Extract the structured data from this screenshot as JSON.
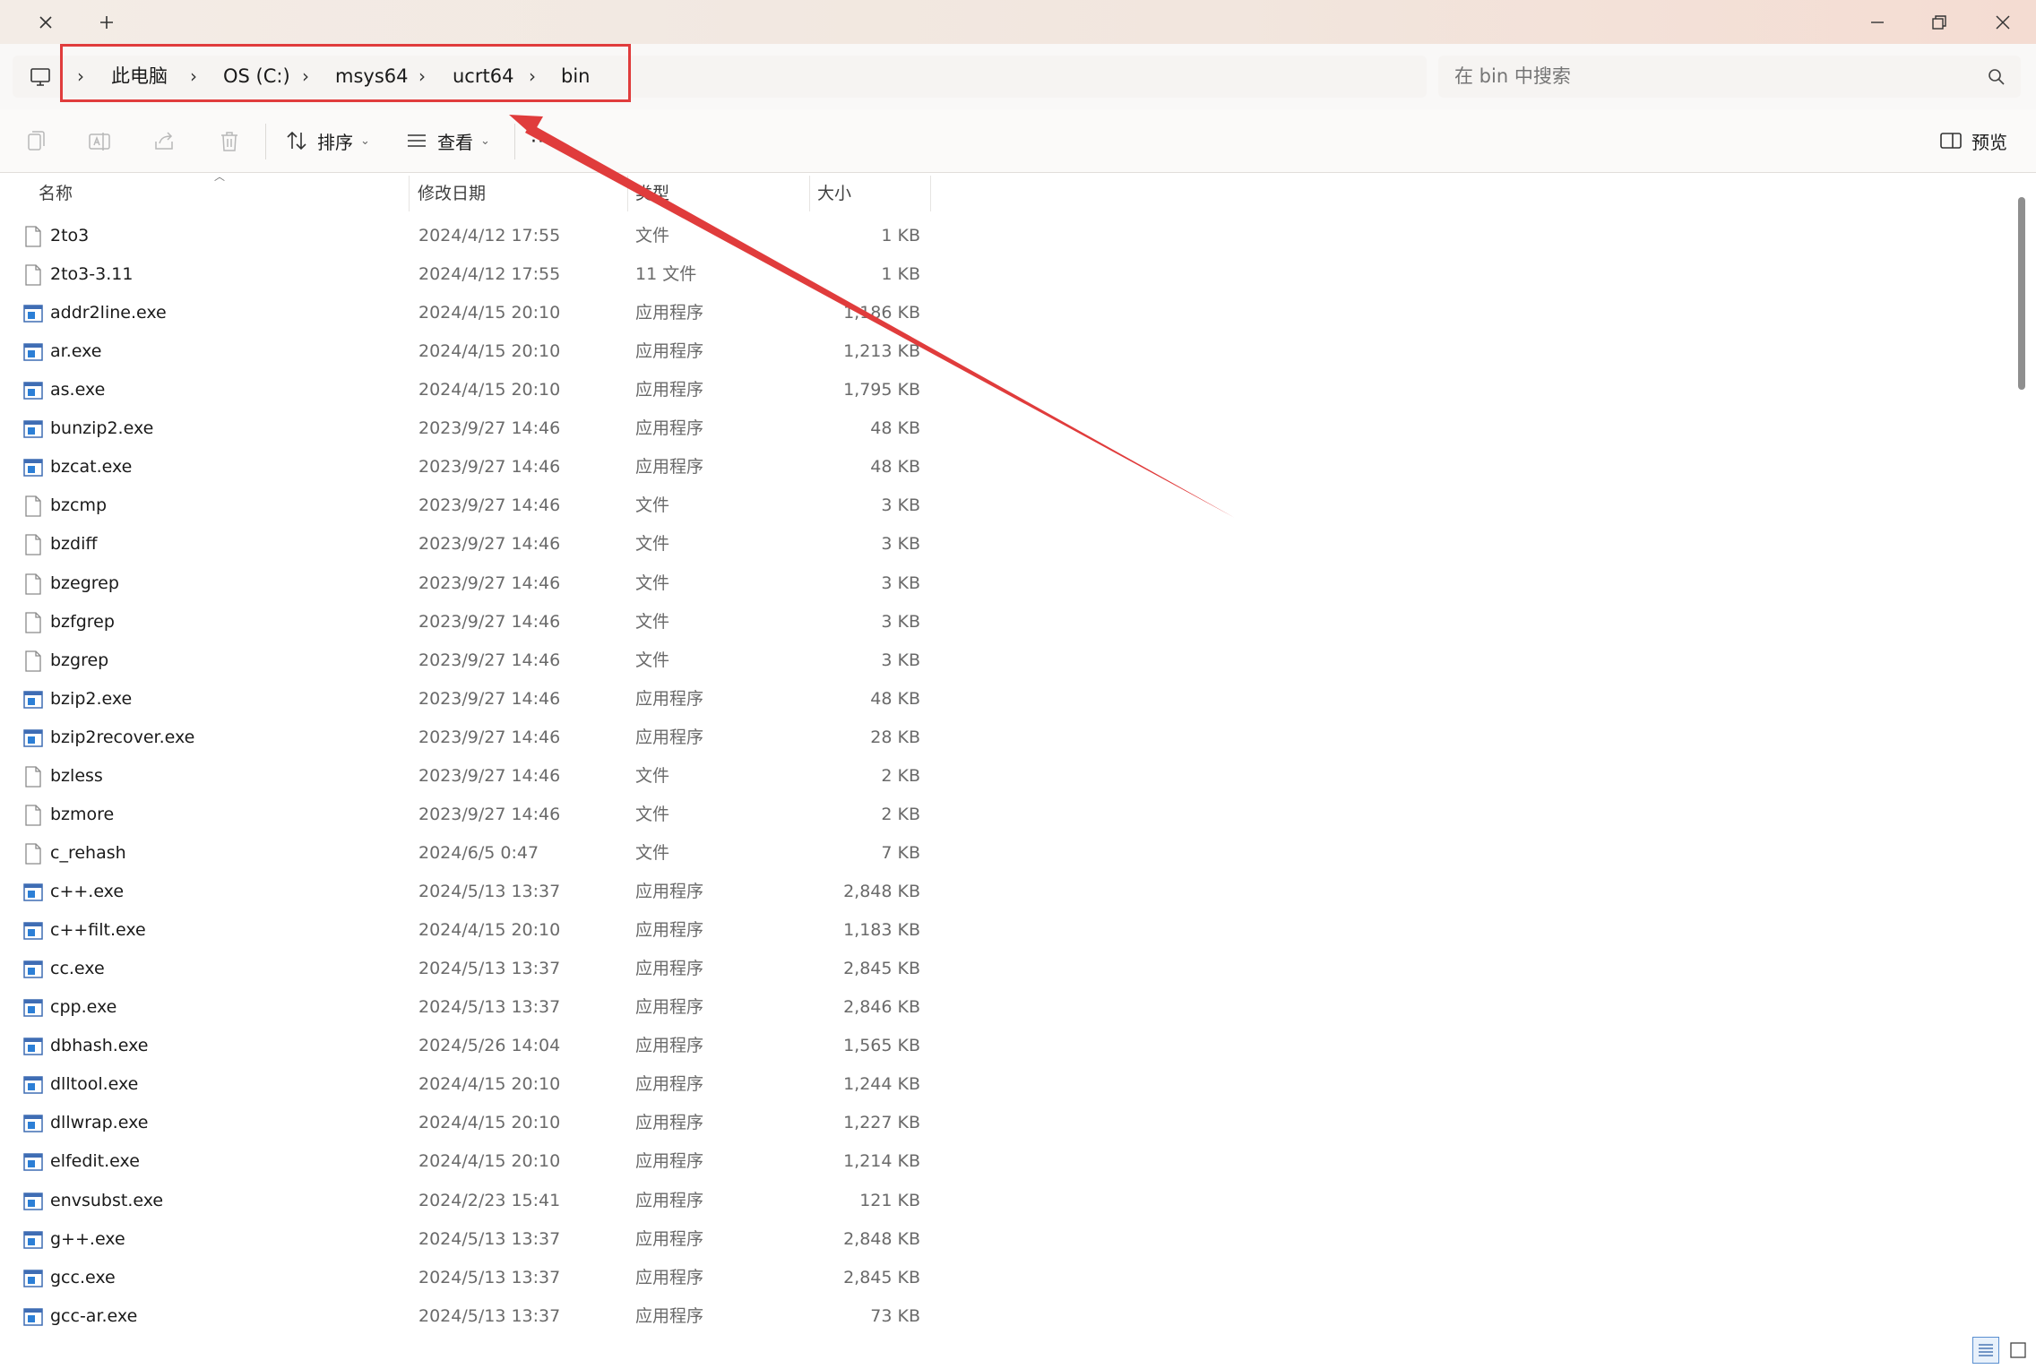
{
  "window": {
    "tab_close_icon": "close-icon",
    "new_tab_icon": "plus-icon",
    "controls": [
      "minimize-icon",
      "restore-icon",
      "close-icon"
    ]
  },
  "address": {
    "root_icon": "computer-icon",
    "breadcrumbs": [
      "此电脑",
      "OS (C:)",
      "msys64",
      "ucrt64",
      "bin"
    ]
  },
  "search": {
    "placeholder": "在 bin 中搜索",
    "icon": "search-icon"
  },
  "toolbar": {
    "icons": [
      "copy-icon",
      "rename-icon",
      "share-icon",
      "delete-icon"
    ],
    "sort_label": "排序",
    "view_label": "查看",
    "more_label": "··",
    "preview_label": "预览"
  },
  "columns": {
    "name": "名称",
    "modified": "修改日期",
    "type": "类型",
    "size": "大小"
  },
  "files": [
    {
      "name": "2to3",
      "date": "2024/4/12 17:55",
      "type": "文件",
      "size": "1 KB",
      "kind": "file"
    },
    {
      "name": "2to3-3.11",
      "date": "2024/4/12 17:55",
      "type": "11 文件",
      "size": "1 KB",
      "kind": "file"
    },
    {
      "name": "addr2line.exe",
      "date": "2024/4/15 20:10",
      "type": "应用程序",
      "size": "1,186 KB",
      "kind": "exe"
    },
    {
      "name": "ar.exe",
      "date": "2024/4/15 20:10",
      "type": "应用程序",
      "size": "1,213 KB",
      "kind": "exe"
    },
    {
      "name": "as.exe",
      "date": "2024/4/15 20:10",
      "type": "应用程序",
      "size": "1,795 KB",
      "kind": "exe"
    },
    {
      "name": "bunzip2.exe",
      "date": "2023/9/27 14:46",
      "type": "应用程序",
      "size": "48 KB",
      "kind": "exe"
    },
    {
      "name": "bzcat.exe",
      "date": "2023/9/27 14:46",
      "type": "应用程序",
      "size": "48 KB",
      "kind": "exe"
    },
    {
      "name": "bzcmp",
      "date": "2023/9/27 14:46",
      "type": "文件",
      "size": "3 KB",
      "kind": "file"
    },
    {
      "name": "bzdiff",
      "date": "2023/9/27 14:46",
      "type": "文件",
      "size": "3 KB",
      "kind": "file"
    },
    {
      "name": "bzegrep",
      "date": "2023/9/27 14:46",
      "type": "文件",
      "size": "3 KB",
      "kind": "file"
    },
    {
      "name": "bzfgrep",
      "date": "2023/9/27 14:46",
      "type": "文件",
      "size": "3 KB",
      "kind": "file"
    },
    {
      "name": "bzgrep",
      "date": "2023/9/27 14:46",
      "type": "文件",
      "size": "3 KB",
      "kind": "file"
    },
    {
      "name": "bzip2.exe",
      "date": "2023/9/27 14:46",
      "type": "应用程序",
      "size": "48 KB",
      "kind": "exe"
    },
    {
      "name": "bzip2recover.exe",
      "date": "2023/9/27 14:46",
      "type": "应用程序",
      "size": "28 KB",
      "kind": "exe"
    },
    {
      "name": "bzless",
      "date": "2023/9/27 14:46",
      "type": "文件",
      "size": "2 KB",
      "kind": "file"
    },
    {
      "name": "bzmore",
      "date": "2023/9/27 14:46",
      "type": "文件",
      "size": "2 KB",
      "kind": "file"
    },
    {
      "name": "c_rehash",
      "date": "2024/6/5 0:47",
      "type": "文件",
      "size": "7 KB",
      "kind": "file"
    },
    {
      "name": "c++.exe",
      "date": "2024/5/13 13:37",
      "type": "应用程序",
      "size": "2,848 KB",
      "kind": "exe"
    },
    {
      "name": "c++filt.exe",
      "date": "2024/4/15 20:10",
      "type": "应用程序",
      "size": "1,183 KB",
      "kind": "exe"
    },
    {
      "name": "cc.exe",
      "date": "2024/5/13 13:37",
      "type": "应用程序",
      "size": "2,845 KB",
      "kind": "exe"
    },
    {
      "name": "cpp.exe",
      "date": "2024/5/13 13:37",
      "type": "应用程序",
      "size": "2,846 KB",
      "kind": "exe"
    },
    {
      "name": "dbhash.exe",
      "date": "2024/5/26 14:04",
      "type": "应用程序",
      "size": "1,565 KB",
      "kind": "exe"
    },
    {
      "name": "dlltool.exe",
      "date": "2024/4/15 20:10",
      "type": "应用程序",
      "size": "1,244 KB",
      "kind": "exe"
    },
    {
      "name": "dllwrap.exe",
      "date": "2024/4/15 20:10",
      "type": "应用程序",
      "size": "1,227 KB",
      "kind": "exe"
    },
    {
      "name": "elfedit.exe",
      "date": "2024/4/15 20:10",
      "type": "应用程序",
      "size": "1,214 KB",
      "kind": "exe"
    },
    {
      "name": "envsubst.exe",
      "date": "2024/2/23 15:41",
      "type": "应用程序",
      "size": "121 KB",
      "kind": "exe"
    },
    {
      "name": "g++.exe",
      "date": "2024/5/13 13:37",
      "type": "应用程序",
      "size": "2,848 KB",
      "kind": "exe"
    },
    {
      "name": "gcc.exe",
      "date": "2024/5/13 13:37",
      "type": "应用程序",
      "size": "2,845 KB",
      "kind": "exe"
    },
    {
      "name": "gcc-ar.exe",
      "date": "2024/5/13 13:37",
      "type": "应用程序",
      "size": "73 KB",
      "kind": "exe"
    }
  ],
  "annotation": {
    "highlight_color": "#e03c3c"
  },
  "view_toggles": [
    "details-view-icon",
    "tiles-view-icon"
  ]
}
